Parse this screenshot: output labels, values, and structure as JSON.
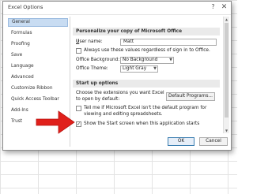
{
  "window": {
    "title": "Excel Options",
    "help": "?",
    "close": "✕"
  },
  "sidebar": {
    "items": [
      {
        "label": "General",
        "active": true
      },
      {
        "label": "Formulas"
      },
      {
        "label": "Proofing"
      },
      {
        "label": "Save"
      },
      {
        "label": "Language"
      },
      {
        "label": "Advanced"
      },
      {
        "label": "Customize Ribbon"
      },
      {
        "label": "Quick Access Toolbar"
      },
      {
        "label": "Add-Ins"
      },
      {
        "label": "Trust"
      }
    ]
  },
  "personalize": {
    "header": "Personalize your copy of Microsoft Office",
    "username_label": "User name:",
    "username_value": "Matt",
    "always_use_label": "Always use these values regardless of sign in to Office.",
    "background_label": "Office Background:",
    "background_value": "No Background",
    "theme_label": "Office Theme:",
    "theme_value": "Light Gray"
  },
  "startup": {
    "header": "Start up options",
    "extensions_line1": "Choose the extensions you want Excel",
    "extensions_line2": "to open by default:",
    "default_programs_button": "Default Programs...",
    "tell_me_line1": "Tell me if Microsoft Excel isn't the default program for",
    "tell_me_line2": "viewing and editing spreadsheets.",
    "show_start_label": "Show the Start screen when this application starts",
    "show_start_checked": true
  },
  "footer": {
    "ok": "OK",
    "cancel": "Cancel"
  },
  "colors": {
    "annotation_arrow": "#e0201b",
    "selected_item": "#c8dcf2"
  }
}
